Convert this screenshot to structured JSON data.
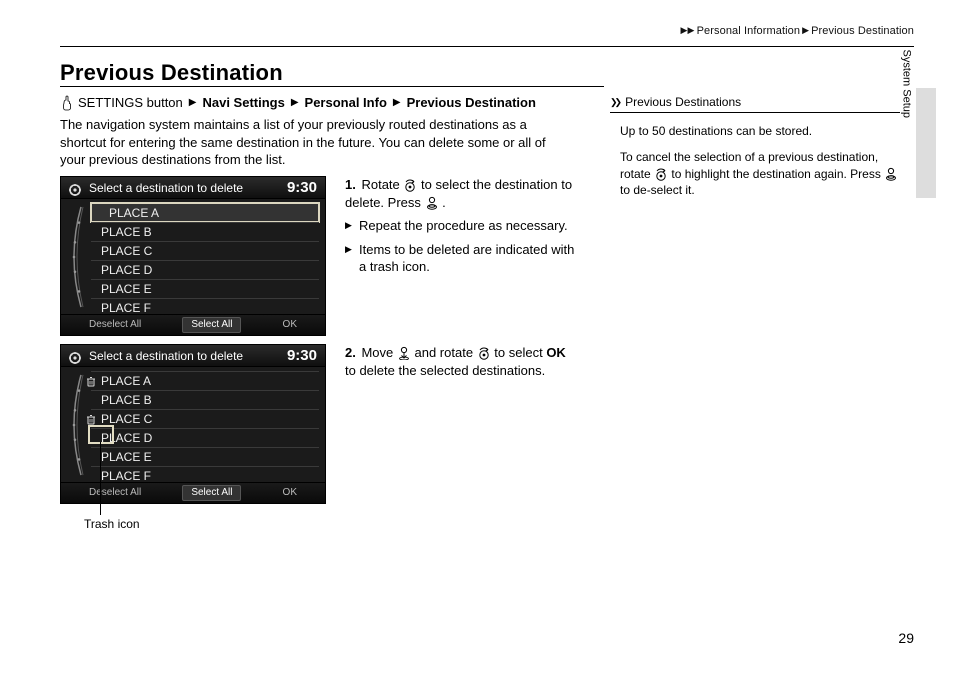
{
  "header_trail": {
    "a": "Personal Information",
    "b": "Previous Destination"
  },
  "title": "Previous Destination",
  "crumb": {
    "lead": "SETTINGS button",
    "b1": "Navi Settings",
    "b2": "Personal Info",
    "b3": "Previous Destination"
  },
  "intro": "The navigation system maintains a list of your previously routed destinations as a shortcut for entering the same destination in the future. You can delete some or all of your previous destinations from the list.",
  "screenshot": {
    "header": "Select a destination to delete",
    "clock": "9:30",
    "places": [
      "PLACE A",
      "PLACE B",
      "PLACE C",
      "PLACE D",
      "PLACE E",
      "PLACE F"
    ],
    "footer": {
      "deselect": "Deselect All",
      "select": "Select All",
      "ok": "OK"
    }
  },
  "callout_trash": "Trash icon",
  "step1": {
    "num": "1.",
    "text_a": "Rotate ",
    "text_b": " to select the destination to delete. Press ",
    "text_c": ".",
    "sub1": "Repeat the procedure as necessary.",
    "sub2": "Items to be deleted are indicated with a trash icon."
  },
  "step2": {
    "num": "2.",
    "text_a": "Move ",
    "text_b": " and rotate ",
    "text_c": " to select ",
    "ok": "OK",
    "text_d": " to delete the selected destinations."
  },
  "right": {
    "title": "Previous Destinations",
    "p1": "Up to 50 destinations can be stored.",
    "p2a": "To cancel the selection of a previous destination, rotate ",
    "p2b": " to highlight the destination again. Press ",
    "p2c": " to de-select it."
  },
  "side_label": "System Setup",
  "page_number": "29"
}
